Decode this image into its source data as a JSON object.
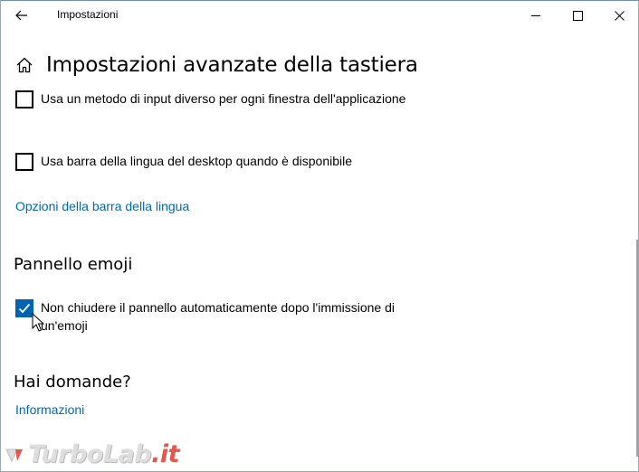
{
  "window": {
    "title": "Impostazioni"
  },
  "header": {
    "title": "Impostazioni avanzate della tastiera"
  },
  "options": {
    "input_method": {
      "label": "Usa un metodo di input diverso per ogni finestra dell'applicazione",
      "checked": false
    },
    "desktop_language_bar": {
      "label": "Usa barra della lingua del desktop quando è disponibile",
      "checked": false
    },
    "language_bar_options_link": "Opzioni della barra della lingua"
  },
  "emoji_panel": {
    "heading": "Pannello emoji",
    "keep_open": {
      "label": "Non chiudere il pannello automaticamente dopo l'immissione di un'emoji",
      "checked": true
    }
  },
  "help": {
    "heading": "Hai domande?",
    "link": "Informazioni"
  },
  "watermark": {
    "text_main": "TurboLab",
    "text_accent": ".it"
  },
  "colors": {
    "accent": "#0063b1",
    "link": "#0067b8",
    "watermark_accent": "#e03a2e"
  },
  "icons": {
    "back": "back-arrow-icon",
    "home": "home-icon",
    "minimize": "minimize-icon",
    "maximize": "maximize-icon",
    "close": "close-icon",
    "check": "checkmark-icon",
    "cursor": "mouse-pointer-icon"
  }
}
